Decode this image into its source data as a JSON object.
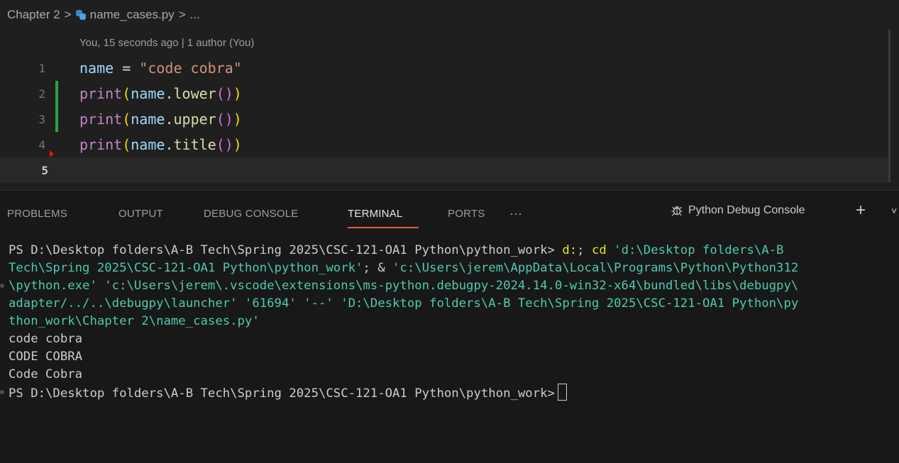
{
  "breadcrumb": {
    "folder": "Chapter 2",
    "file": "name_cases.py",
    "tail": "...",
    "sep": ">"
  },
  "blame": "You, 15 seconds ago | 1 author (You)",
  "editor": {
    "lines": [
      {
        "num": "1",
        "tokens": [
          [
            "var",
            "name"
          ],
          [
            "op",
            " = "
          ],
          [
            "str",
            "\"code cobra\""
          ]
        ]
      },
      {
        "num": "2",
        "tokens": [
          [
            "fn",
            "print"
          ],
          [
            "paren",
            "("
          ],
          [
            "var",
            "name"
          ],
          [
            "dot",
            "."
          ],
          [
            "mth",
            "lower"
          ],
          [
            "paren2",
            "()"
          ],
          [
            "paren",
            ")"
          ]
        ]
      },
      {
        "num": "3",
        "tokens": [
          [
            "fn",
            "print"
          ],
          [
            "paren",
            "("
          ],
          [
            "var",
            "name"
          ],
          [
            "dot",
            "."
          ],
          [
            "mth",
            "upper"
          ],
          [
            "paren2",
            "()"
          ],
          [
            "paren",
            ")"
          ]
        ]
      },
      {
        "num": "4",
        "tokens": [
          [
            "fn",
            "print"
          ],
          [
            "paren",
            "("
          ],
          [
            "var",
            "name"
          ],
          [
            "dot",
            "."
          ],
          [
            "mth",
            "title"
          ],
          [
            "paren2",
            "()"
          ],
          [
            "paren",
            ")"
          ]
        ]
      },
      {
        "num": "5",
        "tokens": []
      }
    ]
  },
  "panel": {
    "tabs": [
      "PROBLEMS",
      "OUTPUT",
      "DEBUG CONSOLE",
      "TERMINAL",
      "PORTS"
    ],
    "more": "···",
    "active_tab": "TERMINAL",
    "terminal_label": "Python Debug Console",
    "add_icon": "+",
    "chevron": "˅"
  },
  "terminal": {
    "l1_prompt": "PS D:\\Desktop folders\\A-B Tech\\Spring 2025\\CSC-121-OA1 Python\\python_work> ",
    "l1_cmd1": "d:",
    "l1_semi": "; ",
    "l1_cmd2": "cd",
    "l1_arg": " 'd:\\Desktop folders\\A-B",
    "l2": "Tech\\Spring 2025\\CSC-121-OA1 Python\\python_work'",
    "l2_amp": "; & ",
    "l2_rest": "'c:\\Users\\jerem\\AppData\\Local\\Programs\\Python\\Python312",
    "l3": "\\python.exe' 'c:\\Users\\jerem\\.vscode\\extensions\\ms-python.debugpy-2024.14.0-win32-x64\\bundled\\libs\\debugpy\\",
    "l4": "adapter/../..\\debugpy\\launcher' '61694' '--' 'D:\\Desktop folders\\A-B Tech\\Spring 2025\\CSC-121-OA1 Python\\py",
    "l5": "thon_work\\Chapter 2\\name_cases.py'",
    "out1": "code cobra",
    "out2": "CODE COBRA",
    "out3": "Code Cobra",
    "l9_prompt": "PS D:\\Desktop folders\\A-B Tech\\Spring 2025\\CSC-121-OA1 Python\\python_work>"
  }
}
